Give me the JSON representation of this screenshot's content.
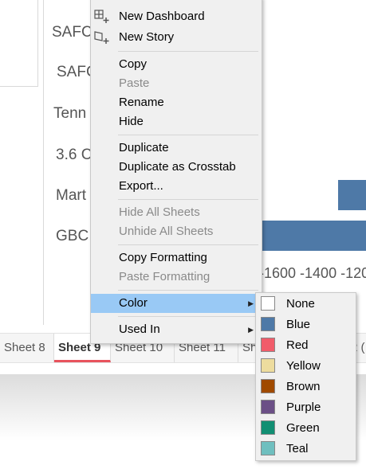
{
  "row_labels": [
    "SAFC",
    "SAFC",
    "Tenn",
    "3.6 C",
    "Mart",
    "GBC"
  ],
  "axis_ticks": "-1600 -1400 -120",
  "tabs": [
    "Sheet 8",
    "Sheet 9",
    "Sheet 10",
    "Sheet 11",
    "Sh",
    "2 ("
  ],
  "context_menu": {
    "new_dashboard": "New Dashboard",
    "new_story": "New Story",
    "copy": "Copy",
    "paste": "Paste",
    "rename": "Rename",
    "hide": "Hide",
    "duplicate": "Duplicate",
    "duplicate_crosstab": "Duplicate as Crosstab",
    "export": "Export...",
    "hide_all": "Hide All Sheets",
    "unhide_all": "Unhide All Sheets",
    "copy_formatting": "Copy Formatting",
    "paste_formatting": "Paste Formatting",
    "color": "Color",
    "used_in": "Used In"
  },
  "color_submenu": [
    {
      "label": "None",
      "color": "#ffffff"
    },
    {
      "label": "Blue",
      "color": "#4e79a7"
    },
    {
      "label": "Red",
      "color": "#f15c6a"
    },
    {
      "label": "Yellow",
      "color": "#eddc9e"
    },
    {
      "label": "Brown",
      "color": "#a04a00"
    },
    {
      "label": "Purple",
      "color": "#6b4f86"
    },
    {
      "label": "Green",
      "color": "#128f73"
    },
    {
      "label": "Teal",
      "color": "#6fbfbf"
    }
  ],
  "colors": {
    "accent_tab": "#e8535d",
    "highlight": "#99c9f5",
    "bar": "#4e79a7"
  }
}
